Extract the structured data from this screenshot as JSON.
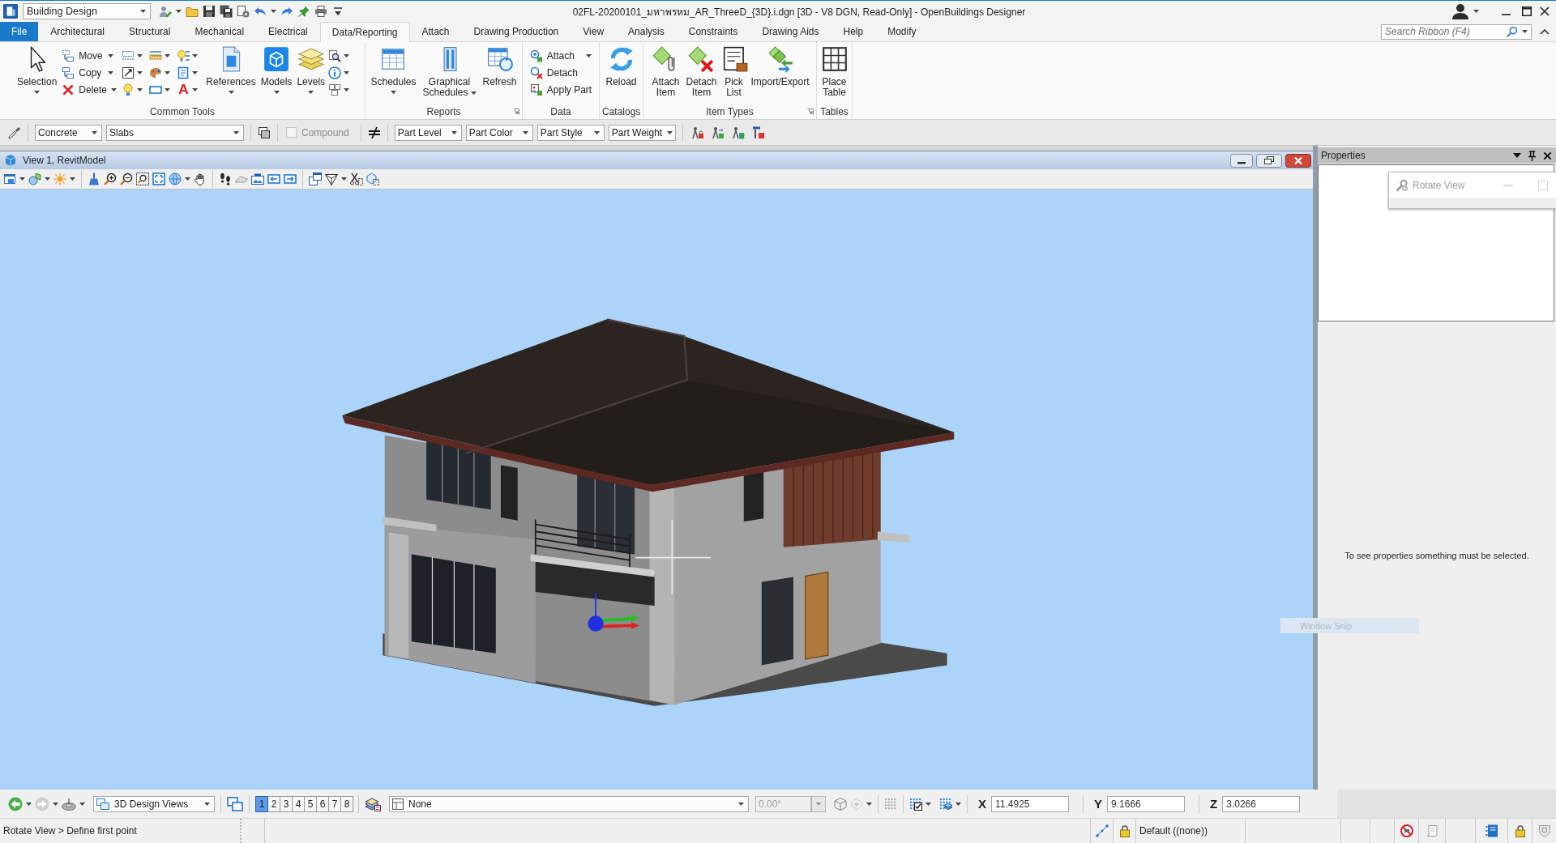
{
  "title_bar": {
    "workflow": "Building Design",
    "title": "02FL-20200101_มหาพรหม_AR_ThreeD_{3D}.i.dgn [3D - V8 DGN, Read-Only] - OpenBuildings Designer"
  },
  "ribbon_tabs": [
    {
      "label": "File",
      "kind": "file",
      "selected": false
    },
    {
      "label": "Architectural",
      "kind": "tab",
      "selected": false
    },
    {
      "label": "Structural",
      "kind": "tab",
      "selected": false
    },
    {
      "label": "Mechanical",
      "kind": "tab",
      "selected": false
    },
    {
      "label": "Electrical",
      "kind": "tab",
      "selected": false
    },
    {
      "label": "Data/Reporting",
      "kind": "tab",
      "selected": true
    },
    {
      "label": "Attach",
      "kind": "tab",
      "selected": false
    },
    {
      "label": "Drawing Production",
      "kind": "tab",
      "selected": false
    },
    {
      "label": "View",
      "kind": "tab",
      "selected": false
    },
    {
      "label": "Analysis",
      "kind": "tab",
      "selected": false
    },
    {
      "label": "Constraints",
      "kind": "tab",
      "selected": false
    },
    {
      "label": "Drawing Aids",
      "kind": "tab",
      "selected": false
    },
    {
      "label": "Help",
      "kind": "tab",
      "selected": false
    },
    {
      "label": "Modify",
      "kind": "tab",
      "selected": false
    }
  ],
  "ribbon_search": {
    "placeholder": "Search Ribbon (F4)"
  },
  "ribbon_groups": [
    {
      "label": "Common Tools",
      "buttons": [
        {
          "label": "Selection"
        },
        {
          "label": "Move"
        },
        {
          "label": "Copy"
        },
        {
          "label": "Delete"
        },
        {
          "label": "References"
        },
        {
          "label": "Models"
        },
        {
          "label": "Levels"
        }
      ],
      "text_glyph": "A"
    },
    {
      "label": "Reports",
      "buttons": [
        {
          "label": "Schedules"
        },
        {
          "label": "Graphical Schedules"
        },
        {
          "label": "Refresh"
        }
      ]
    },
    {
      "label": "Data",
      "buttons": [
        {
          "label": "Attach"
        },
        {
          "label": "Detach"
        },
        {
          "label": "Apply Part"
        }
      ]
    },
    {
      "label": "Catalogs",
      "buttons": [
        {
          "label": "Reload"
        }
      ]
    },
    {
      "label": "Item Types",
      "buttons": [
        {
          "label": "Attach Item"
        },
        {
          "label": "Detach Item"
        },
        {
          "label": "Pick List"
        },
        {
          "label": "Import/Export"
        }
      ]
    },
    {
      "label": "Tables",
      "buttons": [
        {
          "label": "Place Table"
        }
      ]
    }
  ],
  "attribute_bar": {
    "material": "Concrete",
    "part": "Slabs",
    "compound": {
      "label": "Compound",
      "checked": false,
      "disabled": true
    },
    "part_dropdowns": [
      "Part Level",
      "Part Color",
      "Part Style",
      "Part Weight"
    ]
  },
  "view_window": {
    "title": "View 1, RevitModel"
  },
  "properties": {
    "title": "Properties",
    "message": "To see properties something must be selected.",
    "tool_settings": {
      "title": "Rotate View"
    }
  },
  "snip_hint": "Window Snip",
  "view_bar": {
    "view_group": "3D Design Views",
    "views": [
      {
        "label": "1",
        "selected": true
      },
      {
        "label": "2",
        "selected": false
      },
      {
        "label": "3",
        "selected": false
      },
      {
        "label": "4",
        "selected": false
      },
      {
        "label": "5",
        "selected": false
      },
      {
        "label": "6",
        "selected": false
      },
      {
        "label": "7",
        "selected": false
      },
      {
        "label": "8",
        "selected": false
      }
    ],
    "selection": "None",
    "angle": {
      "value": "0.00°",
      "disabled": true
    },
    "coordinates": [
      {
        "axis": "X",
        "value": "11.4925"
      },
      {
        "axis": "Y",
        "value": "9.1666"
      },
      {
        "axis": "Z",
        "value": "3.0266"
      }
    ]
  },
  "status_bar": {
    "prompt": "Rotate View > Define first point",
    "active_level": "Default ((none))"
  }
}
